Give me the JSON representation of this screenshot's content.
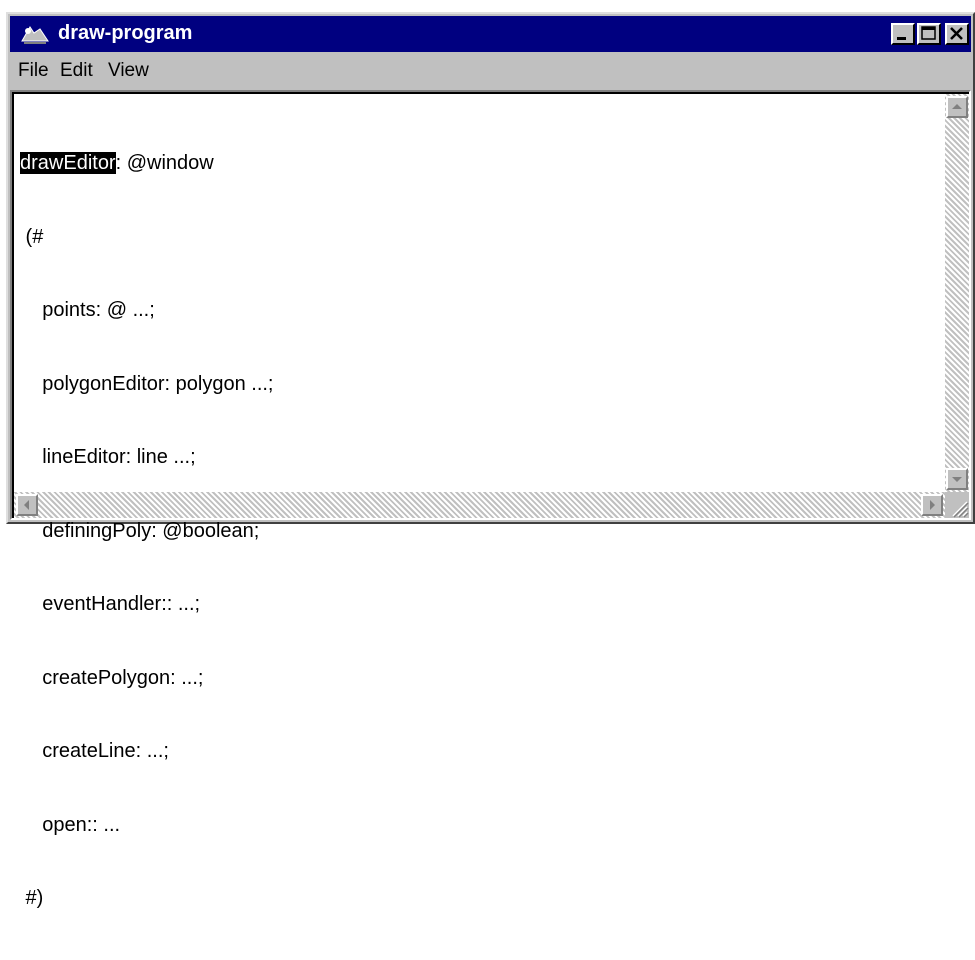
{
  "window": {
    "title": "draw-program",
    "title_bar_color": "#000080",
    "icon": "app-icon"
  },
  "menu": {
    "items": [
      {
        "label": "File"
      },
      {
        "label": "Edit"
      },
      {
        "label": "View"
      }
    ]
  },
  "editor": {
    "selected_text": "drawEditor",
    "first_line_rest": ": @window",
    "lines": [
      " (#",
      "    points: @ ...;",
      "    polygonEditor: polygon ...;",
      "    lineEditor: line ...;",
      "    definingPoly: @boolean;",
      "    eventHandler:: ...;",
      "    createPolygon: ...;",
      "    createLine: ...;",
      "    open:: ...",
      " #)"
    ]
  },
  "controls": {
    "minimize_icon": "minimize-icon",
    "maximize_icon": "maximize-icon",
    "close_icon": "close-icon"
  }
}
